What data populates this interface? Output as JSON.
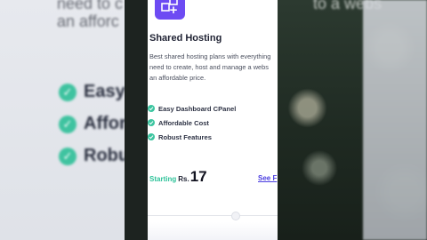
{
  "background": {
    "left_text_lines": [
      "need to c",
      "an afforc"
    ],
    "left_features": [
      "Easy",
      "Afford",
      "Robu"
    ],
    "right_text": "to a webs"
  },
  "card": {
    "icon": "add-apps-icon",
    "title": "Shared Hosting",
    "description_lines": [
      "Best shared hosting plans with everything",
      "need to create, host and manage a webs",
      "an affordable price."
    ],
    "features": [
      {
        "label": "Easy Dashboard CPanel",
        "icon": "check-icon"
      },
      {
        "label": "Affordable Cost",
        "icon": "check-icon"
      },
      {
        "label": "Robust Features",
        "icon": "check-icon"
      }
    ],
    "price": {
      "starting_label": "Starting",
      "currency": "Rs.",
      "amount": "17"
    },
    "see_link": "See F"
  },
  "colors": {
    "accent_purple": "#6d4bf3",
    "check_green": "#3cc5a0",
    "link_blue": "#4b3ee0"
  }
}
